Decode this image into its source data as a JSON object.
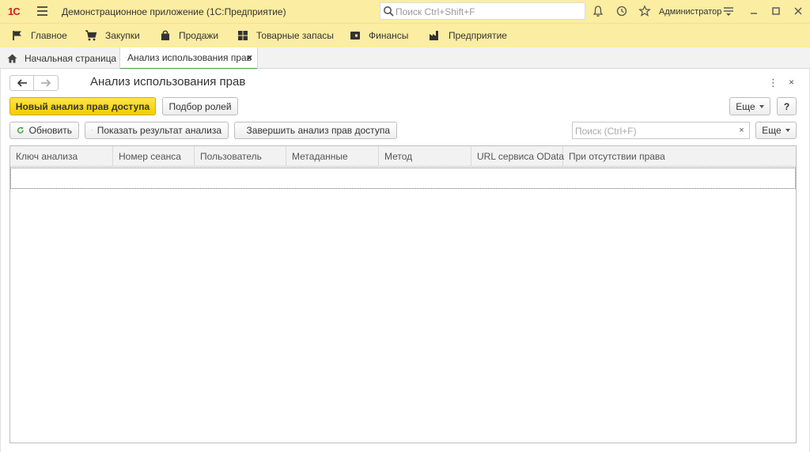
{
  "app": {
    "logo": "1С",
    "title": "Демонстрационное приложение  (1С:Предприятие)",
    "search_placeholder": "Поиск Ctrl+Shift+F",
    "user": "Администратор",
    "icons": [
      "menu-icon",
      "search-icon",
      "bell-icon",
      "history-icon",
      "star-icon",
      "settings-icon",
      "minimize-icon",
      "maximize-icon",
      "close-icon"
    ]
  },
  "sections": [
    {
      "label": "Главное",
      "icon": "flag-icon"
    },
    {
      "label": "Закупки",
      "icon": "cart-icon"
    },
    {
      "label": "Продажи",
      "icon": "bag-icon"
    },
    {
      "label": "Товарные запасы",
      "icon": "grid-icon"
    },
    {
      "label": "Финансы",
      "icon": "wallet-icon"
    },
    {
      "label": "Предприятие",
      "icon": "factory-icon"
    }
  ],
  "tabs": [
    {
      "label": "Начальная страница",
      "icon": "home-icon"
    },
    {
      "label": "Анализ использования прав",
      "close": "×"
    }
  ],
  "form": {
    "title": "Анализ использования прав",
    "more_glyph": "⋮",
    "close_glyph": "×",
    "toolbar1": {
      "new": "Новый анализ прав доступа",
      "roles": "Подбор ролей",
      "more": "Еще",
      "help": "?"
    },
    "toolbar2": {
      "refresh": "Обновить",
      "show": "Показать результат анализа",
      "finish": "Завершить анализ прав доступа",
      "search_placeholder": "Поиск (Ctrl+F)",
      "clear": "×",
      "more": "Еще"
    },
    "columns": [
      "Ключ анализа",
      "Номер сеанса",
      "Пользователь",
      "Метаданные",
      "Метод",
      "URL сервиса OData",
      "При отсутствии права"
    ]
  },
  "colors": {
    "header_bg": "#fbeda1",
    "primary_btn": "#f5cc00",
    "active_tab_underline": "#3fa13f",
    "logo_red": "#d11f1f",
    "refresh_green": "#3fa13f",
    "stop_red": "#e04040"
  }
}
